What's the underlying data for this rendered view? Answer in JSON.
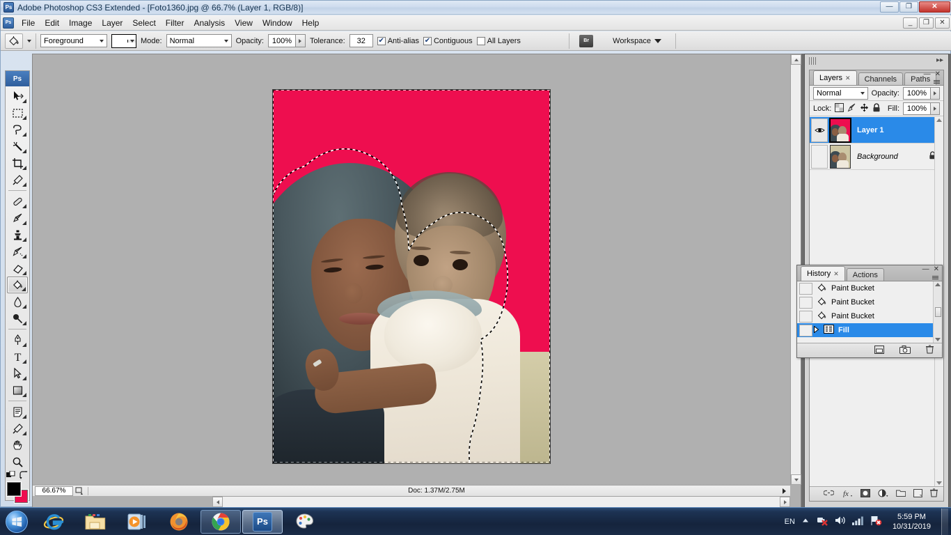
{
  "window": {
    "title": "Adobe Photoshop CS3 Extended - [Foto1360.jpg @ 66.7% (Layer 1, RGB/8)]",
    "app_badge": "Ps",
    "minimize": "—",
    "maximize": "❐",
    "close": "✕",
    "doc_minimize": "_",
    "doc_restore": "❐",
    "doc_close": "✕"
  },
  "menubar": {
    "icon": "photoshop-document-icon",
    "items": [
      "File",
      "Edit",
      "Image",
      "Layer",
      "Select",
      "Filter",
      "Analysis",
      "View",
      "Window",
      "Help"
    ]
  },
  "options_bar": {
    "tool_icon": "paint-bucket-icon",
    "fill_source": "Foreground",
    "swatch_color": "#ffffff",
    "mode_label": "Mode:",
    "mode_value": "Normal",
    "opacity_label": "Opacity:",
    "opacity_value": "100%",
    "tolerance_label": "Tolerance:",
    "tolerance_value": "32",
    "antialias_label": "Anti-alias",
    "antialias_checked": "✔",
    "contiguous_label": "Contiguous",
    "contiguous_checked": "✔",
    "alllayers_label": "All Layers",
    "alllayers_checked": "",
    "bridge_icon": "Br",
    "workspace_label": "Workspace"
  },
  "toolbox": {
    "header_icon": "Ps",
    "tools": [
      {
        "name": "move-tool",
        "glyph": "move"
      },
      {
        "name": "rectangular-marquee-tool",
        "glyph": "marquee"
      },
      {
        "name": "lasso-tool",
        "glyph": "lasso"
      },
      {
        "name": "magic-wand-tool",
        "glyph": "wand"
      },
      {
        "name": "crop-tool",
        "glyph": "crop"
      },
      {
        "name": "eyedropper-tool",
        "glyph": "dropper"
      },
      {
        "name": "healing-brush-tool",
        "glyph": "healing"
      },
      {
        "name": "brush-tool",
        "glyph": "brush"
      },
      {
        "name": "clone-stamp-tool",
        "glyph": "stamp"
      },
      {
        "name": "history-brush-tool",
        "glyph": "historybrush"
      },
      {
        "name": "eraser-tool",
        "glyph": "eraser"
      },
      {
        "name": "paint-bucket-tool",
        "glyph": "bucket",
        "active": true
      },
      {
        "name": "blur-tool",
        "glyph": "blur"
      },
      {
        "name": "dodge-tool",
        "glyph": "dodge"
      },
      {
        "name": "pen-tool",
        "glyph": "pen"
      },
      {
        "name": "horizontal-type-tool",
        "glyph": "type"
      },
      {
        "name": "path-selection-tool",
        "glyph": "pathselect"
      },
      {
        "name": "rectangle-shape-tool",
        "glyph": "shape"
      },
      {
        "name": "notes-tool",
        "glyph": "notes"
      },
      {
        "name": "eyedropper-sample-tool",
        "glyph": "dropper2"
      },
      {
        "name": "hand-tool",
        "glyph": "hand"
      },
      {
        "name": "zoom-tool",
        "glyph": "zoom"
      }
    ],
    "foreground_color": "#000000",
    "background_color": "#ee0e4f",
    "quick_mask_name": "quick-mask-mode",
    "screen_mode_name": "screen-mode"
  },
  "document": {
    "zoom": "66.67%",
    "doc_size": "Doc: 1.37M/2.75M",
    "canvas_fill_color": "#ee0e4f"
  },
  "layers_panel": {
    "tabs": [
      "Layers",
      "Channels",
      "Paths"
    ],
    "active_tab": "Layers",
    "blend_mode": "Normal",
    "opacity_label": "Opacity:",
    "opacity_value": "100%",
    "lock_label": "Lock:",
    "fill_label": "Fill:",
    "fill_value": "100%",
    "lock_icons": [
      "lock-transparency-icon",
      "lock-image-icon",
      "lock-position-icon",
      "lock-all-icon"
    ],
    "layers": [
      {
        "name": "Layer 1",
        "visible": true,
        "selected": true,
        "locked": false,
        "italic": false
      },
      {
        "name": "Background",
        "visible": false,
        "selected": false,
        "locked": true,
        "italic": true
      }
    ],
    "footer_icons": [
      "link-layers-icon",
      "layer-style-icon",
      "layer-mask-icon",
      "adjustment-layer-icon",
      "new-group-icon",
      "new-layer-icon",
      "delete-layer-icon"
    ]
  },
  "history_panel": {
    "tabs": [
      "History",
      "Actions"
    ],
    "active_tab": "History",
    "states": [
      {
        "label": "Paint Bucket",
        "icon": "paint-bucket-icon",
        "selected": false
      },
      {
        "label": "Paint Bucket",
        "icon": "paint-bucket-icon",
        "selected": false
      },
      {
        "label": "Paint Bucket",
        "icon": "paint-bucket-icon",
        "selected": false
      },
      {
        "label": "Fill",
        "icon": "fill-icon",
        "selected": true
      }
    ],
    "footer_icons": [
      "new-document-from-state-icon",
      "new-snapshot-icon",
      "delete-state-icon"
    ]
  },
  "taskbar": {
    "start_name": "start-button",
    "apps": [
      {
        "name": "internet-explorer",
        "label": "e"
      },
      {
        "name": "windows-explorer",
        "label": ""
      },
      {
        "name": "windows-media-player",
        "label": ""
      },
      {
        "name": "mozilla-firefox",
        "label": ""
      },
      {
        "name": "google-chrome",
        "label": ""
      },
      {
        "name": "adobe-photoshop",
        "label": "Ps"
      },
      {
        "name": "paint",
        "label": ""
      }
    ],
    "language": "EN",
    "tray_icons": [
      "show-hidden-icons",
      "power-icon",
      "volume-icon",
      "network-icon",
      "action-center-icon"
    ],
    "time": "5:59 PM",
    "date": "10/31/2019"
  }
}
